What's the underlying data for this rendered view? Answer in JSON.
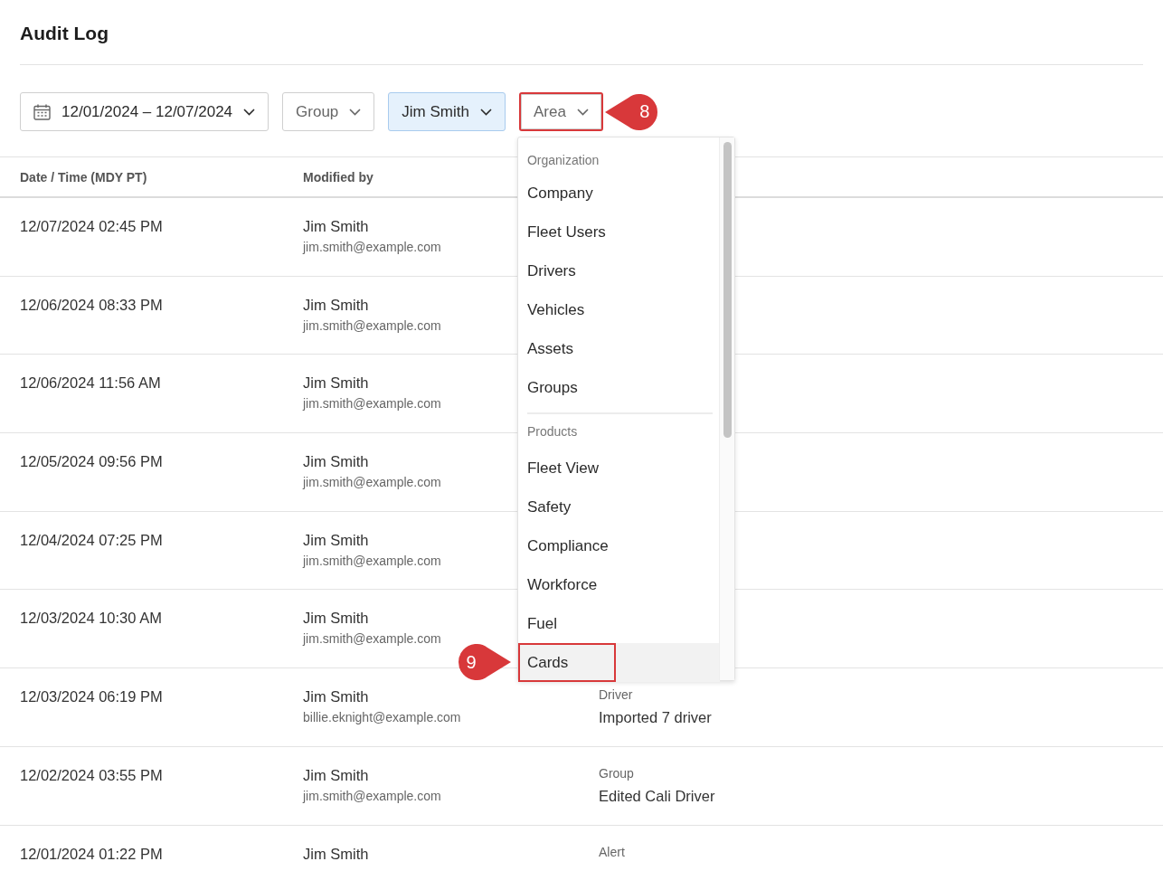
{
  "title": "Audit Log",
  "filters": [
    {
      "kind": "date",
      "label": "12/01/2024 – 12/07/2024",
      "active": false,
      "highlighted": false
    },
    {
      "kind": "select",
      "label": "Group",
      "active": false,
      "highlighted": false
    },
    {
      "kind": "select",
      "label": "Jim Smith",
      "active": true,
      "highlighted": false
    },
    {
      "kind": "select",
      "label": "Area",
      "active": false,
      "highlighted": true,
      "open": true,
      "marker": "8"
    }
  ],
  "table": {
    "columns": [
      "Date / Time (MDY PT)",
      "Modified by"
    ],
    "rows": [
      {
        "date": "12/07/2024 02:45 PM",
        "name": "Jim Smith",
        "email": "jim.smith@example.com"
      },
      {
        "date": "12/06/2024 08:33 PM",
        "name": "Jim Smith",
        "email": "jim.smith@example.com"
      },
      {
        "date": "12/06/2024 11:56 AM",
        "name": "Jim Smith",
        "email": "jim.smith@example.com"
      },
      {
        "date": "12/05/2024 09:56 PM",
        "name": "Jim Smith",
        "email": "jim.smith@example.com"
      },
      {
        "date": "12/04/2024 07:25 PM",
        "name": "Jim Smith",
        "email": "jim.smith@example.com"
      },
      {
        "date": "12/03/2024 10:30 AM",
        "name": "Jim Smith",
        "email": "jim.smith@example.com"
      },
      {
        "date": "12/03/2024 06:19 PM",
        "name": "Jim Smith",
        "email": "billie.eknight@example.com",
        "area": "Driver",
        "action": "Imported 7 driver"
      },
      {
        "date": "12/02/2024 03:55 PM",
        "name": "Jim Smith",
        "email": "jim.smith@example.com",
        "area": "Group",
        "action": "Edited Cali Driver"
      },
      {
        "date": "12/01/2024 01:22 PM",
        "name": "Jim Smith",
        "area": "Alert"
      }
    ]
  },
  "dropdown": {
    "groups": [
      {
        "label": "Organization",
        "items": [
          {
            "label": "Company",
            "selected": false
          },
          {
            "label": "Fleet Users",
            "selected": false
          },
          {
            "label": "Drivers",
            "selected": false
          },
          {
            "label": "Vehicles",
            "selected": false
          },
          {
            "label": "Assets",
            "selected": false
          },
          {
            "label": "Groups",
            "selected": false
          }
        ]
      },
      {
        "label": "Products",
        "items": [
          {
            "label": "Fleet View",
            "selected": false
          },
          {
            "label": "Safety",
            "selected": false
          },
          {
            "label": "Compliance",
            "selected": false
          },
          {
            "label": "Workforce",
            "selected": false
          },
          {
            "label": "Fuel",
            "selected": false
          },
          {
            "label": "Cards",
            "selected": true,
            "highlighted": true,
            "marker": "9"
          }
        ]
      }
    ]
  }
}
